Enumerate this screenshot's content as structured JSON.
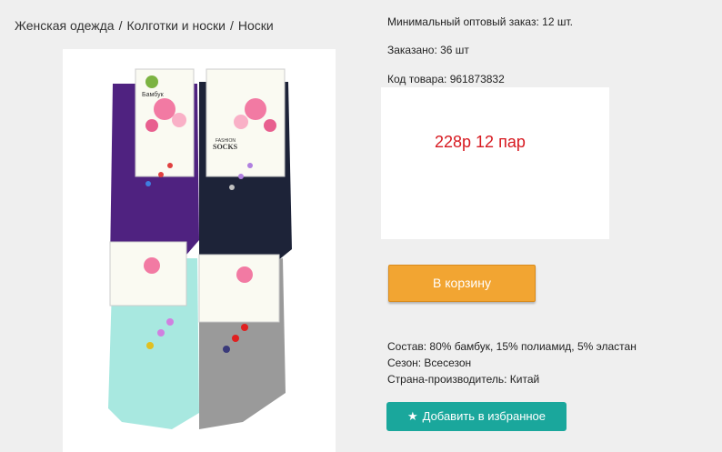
{
  "breadcrumb": {
    "item1": "Женская одежда",
    "item2": "Колготки и носки",
    "item3": "Носки",
    "separator": "/"
  },
  "product": {
    "min_order": "Минимальный оптовый заказ: 12 шт.",
    "ordered": "Заказано: 36 шт",
    "code": "Код товара: 961873832",
    "price": "228р 12 пар",
    "image_alt": "Носки женские Бамбук"
  },
  "image_text": {
    "brand": "Бамбук",
    "line1": "FASHION",
    "line2": "SOCKS"
  },
  "actions": {
    "cart": "В корзину",
    "favorite": "Добавить в избранное",
    "favorite_icon": "star-icon"
  },
  "attributes": {
    "composition": "Состав: 80% бамбук, 15% полиамид, 5% эластан",
    "season": "Сезон: Всесезон",
    "country": "Страна-производитель: Китай"
  },
  "colors": {
    "price": "#d71920",
    "cart_button": "#f2a532",
    "favorite_button": "#1aa79c"
  }
}
